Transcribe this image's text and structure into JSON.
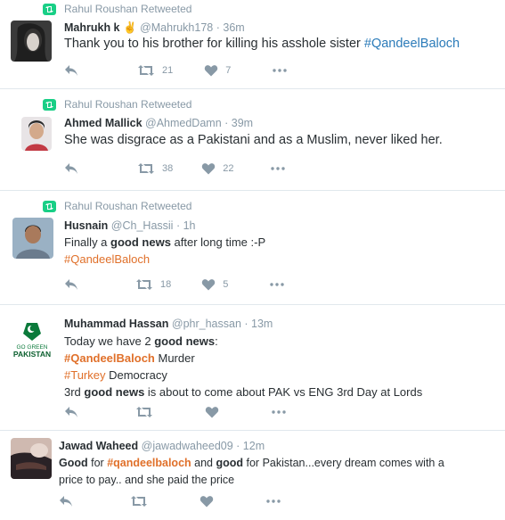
{
  "colors": {
    "hashtag": "#e0702a",
    "hashtag_alt": "#2b7bb9",
    "muted": "#8899a6",
    "retweet_badge": "#19cf86"
  },
  "tweets": [
    {
      "retweeted_by": "Rahul Roushan Retweeted",
      "name": "Mahrukh k",
      "emoji": "✌",
      "handle": "@Mahrukh178",
      "time": "· 36m",
      "lines": [
        {
          "a": "Thank you to his brother for killing his asshole sister ",
          "tag": "#QandeelBaloch"
        }
      ],
      "retweets": "21",
      "likes": "7",
      "icons": {
        "reply": "reply-icon",
        "retweet": "retweet-icon",
        "like": "heart-icon",
        "more": "more-icon"
      }
    },
    {
      "retweeted_by": "Rahul Roushan Retweeted",
      "name": "Ahmed Mallick",
      "handle": "@AhmedDamn",
      "time": "· 39m",
      "lines": [
        {
          "a": "She was disgrace as a Pakistani and as a Muslim, never liked her."
        }
      ],
      "retweets": "38",
      "likes": "22"
    },
    {
      "retweeted_by": "Rahul Roushan Retweeted",
      "name": "Husnain",
      "handle": "@Ch_Hassii",
      "time": "· 1h",
      "lines": [
        {
          "a": "Finally a ",
          "b": "good news",
          "c": " after long time :-P"
        },
        {
          "tag": "#QandeelBaloch"
        }
      ],
      "retweets": "18",
      "likes": "5"
    },
    {
      "name": "Muhammad Hassan",
      "handle": "@phr_hassan",
      "time": "· 13m",
      "avatar_text": {
        "top": "GO GREEN",
        "main": "PAKISTAN"
      },
      "lines": [
        {
          "a": "Today we have 2 ",
          "b": "good news",
          "c": ":"
        },
        {
          "tag": "#QandeelBaloch",
          "c": " Murder"
        },
        {
          "tag": "#Turkey",
          "c": " Democracy"
        },
        {
          "a": "3rd ",
          "b": "good news",
          "c": " is about to come about PAK vs ENG 3rd Day at Lords"
        }
      ]
    },
    {
      "name": "Jawad Waheed",
      "handle": "@jawadwaheed09",
      "time": "· 12m",
      "lines": [
        {
          "b": "Good",
          "a": " for ",
          "tag": "#qandeelbaloch",
          "c": " and ",
          "d": "good",
          "e": " for Pakistan...every dream comes with a"
        },
        {
          "a": "price to pay.. and she paid the price"
        }
      ]
    }
  ]
}
